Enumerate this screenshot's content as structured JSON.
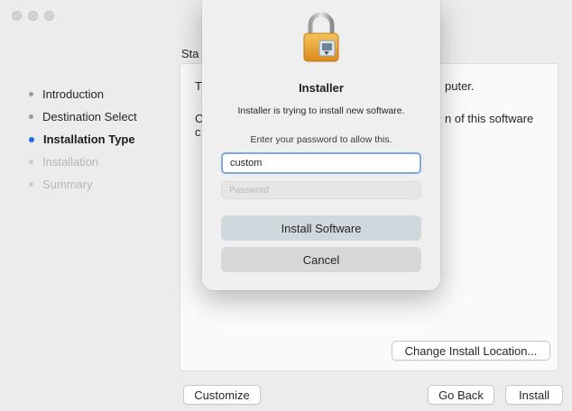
{
  "sidebar": {
    "items": [
      {
        "label": "Introduction",
        "state": "done"
      },
      {
        "label": "Destination Select",
        "state": "done"
      },
      {
        "label": "Installation Type",
        "state": "active"
      },
      {
        "label": "Installation",
        "state": "pending"
      },
      {
        "label": "Summary",
        "state": "pending"
      }
    ]
  },
  "content": {
    "title_fragment": "Sta",
    "text_fragments": [
      "T",
      "C",
      "c",
      "puter.",
      "n of this software"
    ]
  },
  "buttons": {
    "change_location": "Change Install Location...",
    "customize": "Customize",
    "go_back": "Go Back",
    "install": "Install"
  },
  "dialog": {
    "title": "Installer",
    "message": "Installer is trying to install new software.",
    "prompt": "Enter your password to allow this.",
    "username_value": "custom",
    "password_placeholder": "Password",
    "primary_button": "Install Software",
    "cancel_button": "Cancel",
    "icon": "lock-icon"
  },
  "colors": {
    "accent": "#1e6fe0",
    "focus_ring": "#7fa7e2",
    "lock_gold": "#e8a532"
  }
}
